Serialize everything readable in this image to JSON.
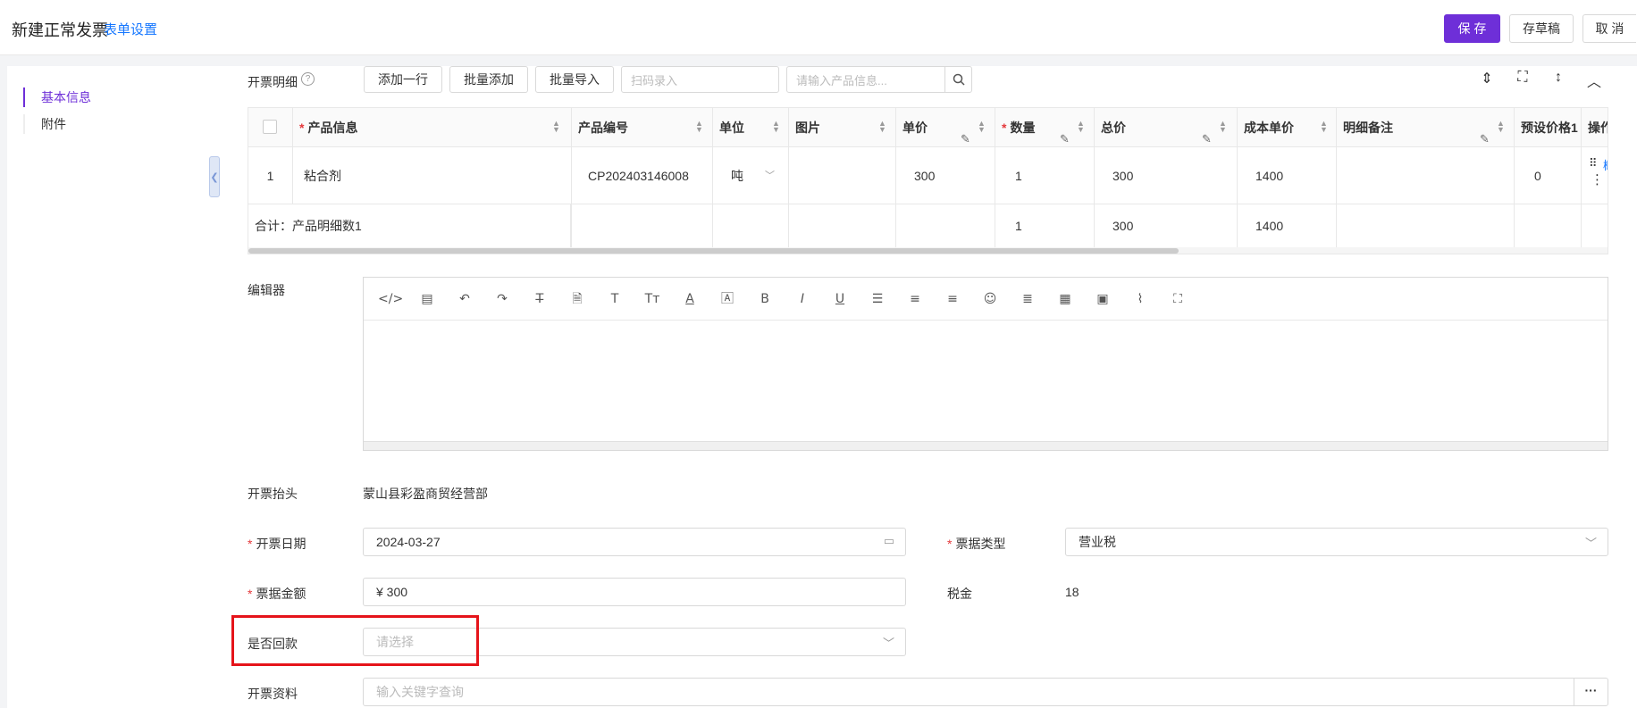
{
  "header": {
    "title": "新建正常发票",
    "form_settings": "表单设置",
    "save": "保 存",
    "draft": "存草稿",
    "cancel": "取 消"
  },
  "nav": {
    "items": [
      {
        "label": "基本信息",
        "active": true
      },
      {
        "label": "附件",
        "active": false
      }
    ],
    "collapse_icon": "chevron-left-icon"
  },
  "detail": {
    "label": "开票明细",
    "help_icon": "question-circle-icon",
    "add_row": "添加一行",
    "batch_add": "批量添加",
    "batch_import": "批量导入",
    "scan_placeholder": "扫码录入",
    "product_search_placeholder": "请输入产品信息...",
    "toolbar_icons": [
      "density-icon",
      "fullscreen-icon",
      "column-height-icon",
      "chevron-up-icon"
    ]
  },
  "table": {
    "headers": {
      "product_info": "产品信息",
      "product_code": "产品编号",
      "unit": "单位",
      "image": "图片",
      "unit_price": "单价",
      "quantity": "数量",
      "total": "总价",
      "cost_price": "成本单价",
      "remark": "明细备注",
      "preset_price": "预设价格1",
      "actions": "操作"
    },
    "rows": [
      {
        "index": "1",
        "product_info": "粘合剂",
        "product_code": "CP202403146008",
        "unit": "吨",
        "image": "",
        "unit_price": "300",
        "quantity": "1",
        "total": "300",
        "cost_price": "1400",
        "remark": "",
        "preset_price": "0",
        "action_link": "概要"
      }
    ],
    "summary": {
      "label": "合计：产品明细数1",
      "quantity": "1",
      "total": "300",
      "cost_price": "1400"
    }
  },
  "editor": {
    "label": "编辑器",
    "tools": [
      "code-icon",
      "template-icon",
      "undo-icon",
      "redo-icon",
      "strikethrough-icon",
      "paste-doc-icon",
      "font-icon",
      "font-size-icon",
      "font-color-icon",
      "background-color-icon",
      "bold-icon",
      "italic-icon",
      "underline-icon",
      "align-left-icon",
      "align-center-icon",
      "align-right-icon",
      "emoji-icon",
      "line-height-icon",
      "table-icon",
      "image-icon",
      "attachment-icon",
      "fullscreen-icon"
    ]
  },
  "form": {
    "invoice_title_label": "开票抬头",
    "invoice_title_value": "蒙山县彩盈商贸经营部",
    "invoice_date_label": "开票日期",
    "invoice_date_value": "2024-03-27",
    "receipt_type_label": "票据类型",
    "receipt_type_value": "营业税",
    "amount_label": "票据金额",
    "amount_value": "¥ 300",
    "tax_label": "税金",
    "tax_value": "18",
    "repaid_label": "是否回款",
    "repaid_placeholder": "请选择",
    "invoice_info_label": "开票资料",
    "invoice_info_placeholder": "输入关键字查询",
    "more_button": "···"
  },
  "colors": {
    "primary": "#6e2fd8",
    "link": "#1677ff",
    "required": "#e4393c",
    "highlight_box": "#e5141a"
  }
}
